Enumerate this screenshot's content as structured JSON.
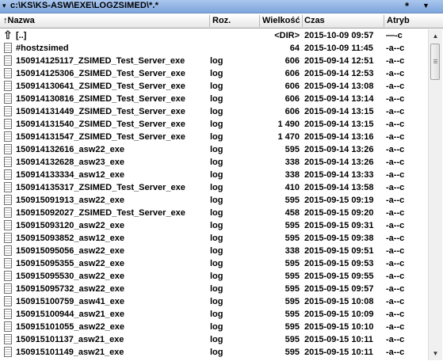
{
  "path_bar": {
    "drive_dropdown": "▾",
    "path": "c:\\KS\\KS-ASW\\EXE\\LOGZSIMED\\*.*",
    "star": "*",
    "history_dropdown": "▼"
  },
  "columns": {
    "name": "↑Nazwa",
    "ext": "Roz.",
    "size": "Wielkość",
    "date": "Czas",
    "attr": "Atryb"
  },
  "files": [
    {
      "name": "[..]",
      "ext": "",
      "size": "<DIR>",
      "date": "2015-10-09 09:57",
      "attr": "—-c",
      "icon": "up-dir-icon"
    },
    {
      "name": "#hostzsimed",
      "ext": "",
      "size": "64",
      "date": "2015-10-09 11:45",
      "attr": "-a--c",
      "icon": "file-icon"
    },
    {
      "name": "150914125117_ZSIMED_Test_Server_exe",
      "ext": "log",
      "size": "606",
      "date": "2015-09-14 12:51",
      "attr": "-a--c",
      "icon": "file-icon"
    },
    {
      "name": "150914125306_ZSIMED_Test_Server_exe",
      "ext": "log",
      "size": "606",
      "date": "2015-09-14 12:53",
      "attr": "-a--c",
      "icon": "file-icon"
    },
    {
      "name": "150914130641_ZSIMED_Test_Server_exe",
      "ext": "log",
      "size": "606",
      "date": "2015-09-14 13:08",
      "attr": "-a--c",
      "icon": "file-icon"
    },
    {
      "name": "150914130816_ZSIMED_Test_Server_exe",
      "ext": "log",
      "size": "606",
      "date": "2015-09-14 13:14",
      "attr": "-a--c",
      "icon": "file-icon"
    },
    {
      "name": "150914131449_ZSIMED_Test_Server_exe",
      "ext": "log",
      "size": "606",
      "date": "2015-09-14 13:15",
      "attr": "-a--c",
      "icon": "file-icon"
    },
    {
      "name": "150914131540_ZSIMED_Test_Server_exe",
      "ext": "log",
      "size": "1 490",
      "date": "2015-09-14 13:15",
      "attr": "-a--c",
      "icon": "file-icon"
    },
    {
      "name": "150914131547_ZSIMED_Test_Server_exe",
      "ext": "log",
      "size": "1 470",
      "date": "2015-09-14 13:16",
      "attr": "-a--c",
      "icon": "file-icon"
    },
    {
      "name": "150914132616_asw22_exe",
      "ext": "log",
      "size": "595",
      "date": "2015-09-14 13:26",
      "attr": "-a--c",
      "icon": "file-icon"
    },
    {
      "name": "150914132628_asw23_exe",
      "ext": "log",
      "size": "338",
      "date": "2015-09-14 13:26",
      "attr": "-a--c",
      "icon": "file-icon"
    },
    {
      "name": "150914133334_asw12_exe",
      "ext": "log",
      "size": "338",
      "date": "2015-09-14 13:33",
      "attr": "-a--c",
      "icon": "file-icon"
    },
    {
      "name": "150914135317_ZSIMED_Test_Server_exe",
      "ext": "log",
      "size": "410",
      "date": "2015-09-14 13:58",
      "attr": "-a--c",
      "icon": "file-icon"
    },
    {
      "name": "150915091913_asw22_exe",
      "ext": "log",
      "size": "595",
      "date": "2015-09-15 09:19",
      "attr": "-a--c",
      "icon": "file-icon"
    },
    {
      "name": "150915092027_ZSIMED_Test_Server_exe",
      "ext": "log",
      "size": "458",
      "date": "2015-09-15 09:20",
      "attr": "-a--c",
      "icon": "file-icon"
    },
    {
      "name": "150915093120_asw22_exe",
      "ext": "log",
      "size": "595",
      "date": "2015-09-15 09:31",
      "attr": "-a--c",
      "icon": "file-icon"
    },
    {
      "name": "150915093852_asw12_exe",
      "ext": "log",
      "size": "595",
      "date": "2015-09-15 09:38",
      "attr": "-a--c",
      "icon": "file-icon"
    },
    {
      "name": "150915095056_asw22_exe",
      "ext": "log",
      "size": "338",
      "date": "2015-09-15 09:51",
      "attr": "-a--c",
      "icon": "file-icon"
    },
    {
      "name": "150915095355_asw22_exe",
      "ext": "log",
      "size": "595",
      "date": "2015-09-15 09:53",
      "attr": "-a--c",
      "icon": "file-icon"
    },
    {
      "name": "150915095530_asw22_exe",
      "ext": "log",
      "size": "595",
      "date": "2015-09-15 09:55",
      "attr": "-a--c",
      "icon": "file-icon"
    },
    {
      "name": "150915095732_asw22_exe",
      "ext": "log",
      "size": "595",
      "date": "2015-09-15 09:57",
      "attr": "-a--c",
      "icon": "file-icon"
    },
    {
      "name": "150915100759_asw41_exe",
      "ext": "log",
      "size": "595",
      "date": "2015-09-15 10:08",
      "attr": "-a--c",
      "icon": "file-icon"
    },
    {
      "name": "150915100944_asw21_exe",
      "ext": "log",
      "size": "595",
      "date": "2015-09-15 10:09",
      "attr": "-a--c",
      "icon": "file-icon"
    },
    {
      "name": "150915101055_asw22_exe",
      "ext": "log",
      "size": "595",
      "date": "2015-09-15 10:10",
      "attr": "-a--c",
      "icon": "file-icon"
    },
    {
      "name": "150915101137_asw21_exe",
      "ext": "log",
      "size": "595",
      "date": "2015-09-15 10:11",
      "attr": "-a--c",
      "icon": "file-icon"
    },
    {
      "name": "150915101149_asw21_exe",
      "ext": "log",
      "size": "595",
      "date": "2015-09-15 10:11",
      "attr": "-a--c",
      "icon": "file-icon"
    }
  ],
  "scrollbar": {
    "up_arrow": "▲",
    "down_arrow": "▼",
    "position": 0.0
  },
  "colors": {
    "path_bar": "#8fb2e4",
    "header": "#ececec",
    "text": "#000000"
  }
}
